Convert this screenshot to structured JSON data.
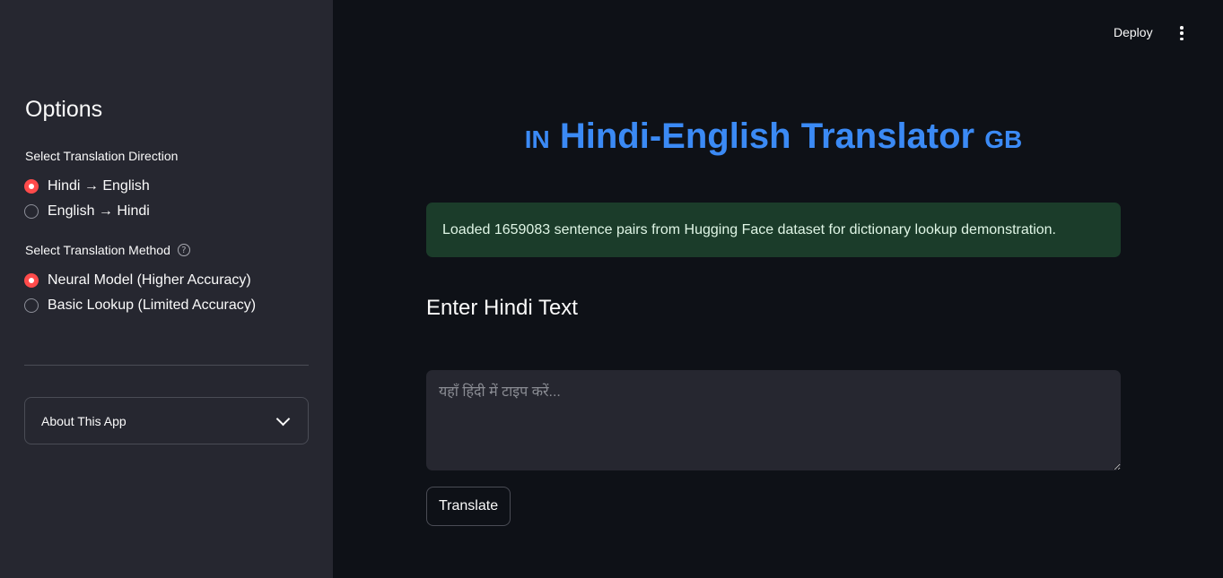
{
  "sidebar": {
    "title": "Options",
    "direction": {
      "label": "Select Translation Direction",
      "options": [
        {
          "label": "Hindi → English",
          "checked": true
        },
        {
          "label": "English → Hindi",
          "checked": false
        }
      ]
    },
    "method": {
      "label": "Select Translation Method",
      "help_icon": "question-circle-icon",
      "options": [
        {
          "label": "Neural Model (Higher Accuracy)",
          "checked": true
        },
        {
          "label": "Basic Lookup (Limited Accuracy)",
          "checked": false
        }
      ]
    },
    "expander": {
      "label": "About This App",
      "icon": "chevron-down-icon"
    }
  },
  "header": {
    "deploy_label": "Deploy",
    "menu_icon": "kebab-menu-icon"
  },
  "main": {
    "title_prefix": "IN",
    "title": "Hindi-English Translator",
    "title_suffix": "GB",
    "success_message": "Loaded 1659083 sentence pairs from Hugging Face dataset for dictionary lookup demonstration.",
    "input_header": "Enter Hindi Text",
    "input_placeholder": "यहाँ हिंदी में टाइप करें...",
    "input_value": "",
    "translate_button": "Translate"
  },
  "colors": {
    "accent": "#ff4b4b",
    "title": "#3b8af5",
    "success_bg": "#1b3c2a",
    "sidebar_bg": "#262730",
    "main_bg": "#0e1117"
  }
}
